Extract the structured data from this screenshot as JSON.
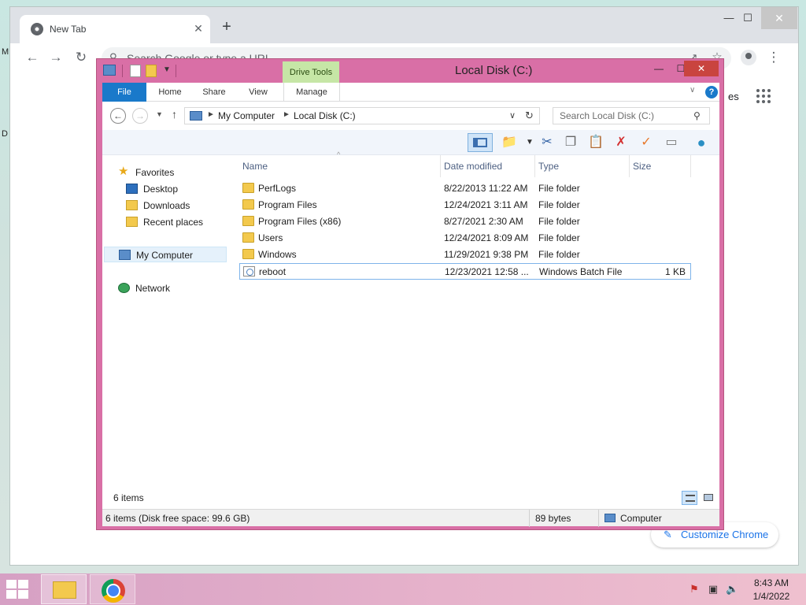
{
  "desktop": {
    "fragment_1": "M",
    "fragment_2": "D"
  },
  "chrome": {
    "tab_title": "New Tab",
    "tab_close": "✕",
    "new_tab": "+",
    "controls": {
      "minimize": "—",
      "maximize": "☐",
      "close": "✕"
    },
    "nav": {
      "back": "←",
      "forward": "→",
      "reload": "↻"
    },
    "omnibox": {
      "placeholder": "Search Google or type a URL",
      "value": ""
    },
    "images_link": "es",
    "customize_label": "Customize Chrome"
  },
  "explorer": {
    "title": "Local Disk (C:)",
    "contextual_tab": "Drive Tools",
    "controls": {
      "minimize": "—",
      "maximize": "☐",
      "close": "✕"
    },
    "ribbon_tabs": [
      {
        "label": "File"
      },
      {
        "label": "Home"
      },
      {
        "label": "Share"
      },
      {
        "label": "View"
      },
      {
        "label": "Manage"
      }
    ],
    "address": {
      "crumbs": [
        "My Computer",
        "Local Disk (C:)"
      ]
    },
    "search": {
      "placeholder": "Search Local Disk (C:)",
      "value": ""
    },
    "nav_pane": {
      "items": [
        {
          "label": "Favorites",
          "icon": "star-icon"
        },
        {
          "label": "Desktop",
          "icon": "monitor-icon"
        },
        {
          "label": "Downloads",
          "icon": "downloads-folder-icon"
        },
        {
          "label": "Recent places",
          "icon": "recent-places-icon"
        },
        {
          "label": "My Computer",
          "icon": "computer-icon"
        },
        {
          "label": "Network",
          "icon": "network-icon"
        }
      ]
    },
    "columns": [
      "Name",
      "Date modified",
      "Type",
      "Size"
    ],
    "files": [
      {
        "name": "PerfLogs",
        "date": "8/22/2013 11:22 AM",
        "type": "File folder",
        "size": "",
        "icon": "folder-icon"
      },
      {
        "name": "Program Files",
        "date": "12/24/2021 3:11 AM",
        "type": "File folder",
        "size": "",
        "icon": "folder-icon"
      },
      {
        "name": "Program Files (x86)",
        "date": "8/27/2021 2:30 AM",
        "type": "File folder",
        "size": "",
        "icon": "folder-icon"
      },
      {
        "name": "Users",
        "date": "12/24/2021 8:09 AM",
        "type": "File folder",
        "size": "",
        "icon": "folder-icon"
      },
      {
        "name": "Windows",
        "date": "11/29/2021 9:38 PM",
        "type": "File folder",
        "size": "",
        "icon": "folder-icon"
      },
      {
        "name": "reboot",
        "date": "12/23/2021 12:58 ...",
        "type": "Windows Batch File",
        "size": "1 KB",
        "icon": "batch-file-icon"
      }
    ],
    "item_count": "6 items",
    "status": {
      "disk_info": "6 items (Disk free space: 99.6 GB)",
      "bytes": "89 bytes",
      "location": "Computer"
    }
  },
  "taskbar": {
    "time": "8:43 AM",
    "date": "1/4/2022"
  },
  "colors": {
    "explorer_frame": "#d96fa6",
    "ribbon_file_tab": "#1979ca",
    "drive_tools": "#c6e6a6",
    "close_button": "#c9443f"
  }
}
